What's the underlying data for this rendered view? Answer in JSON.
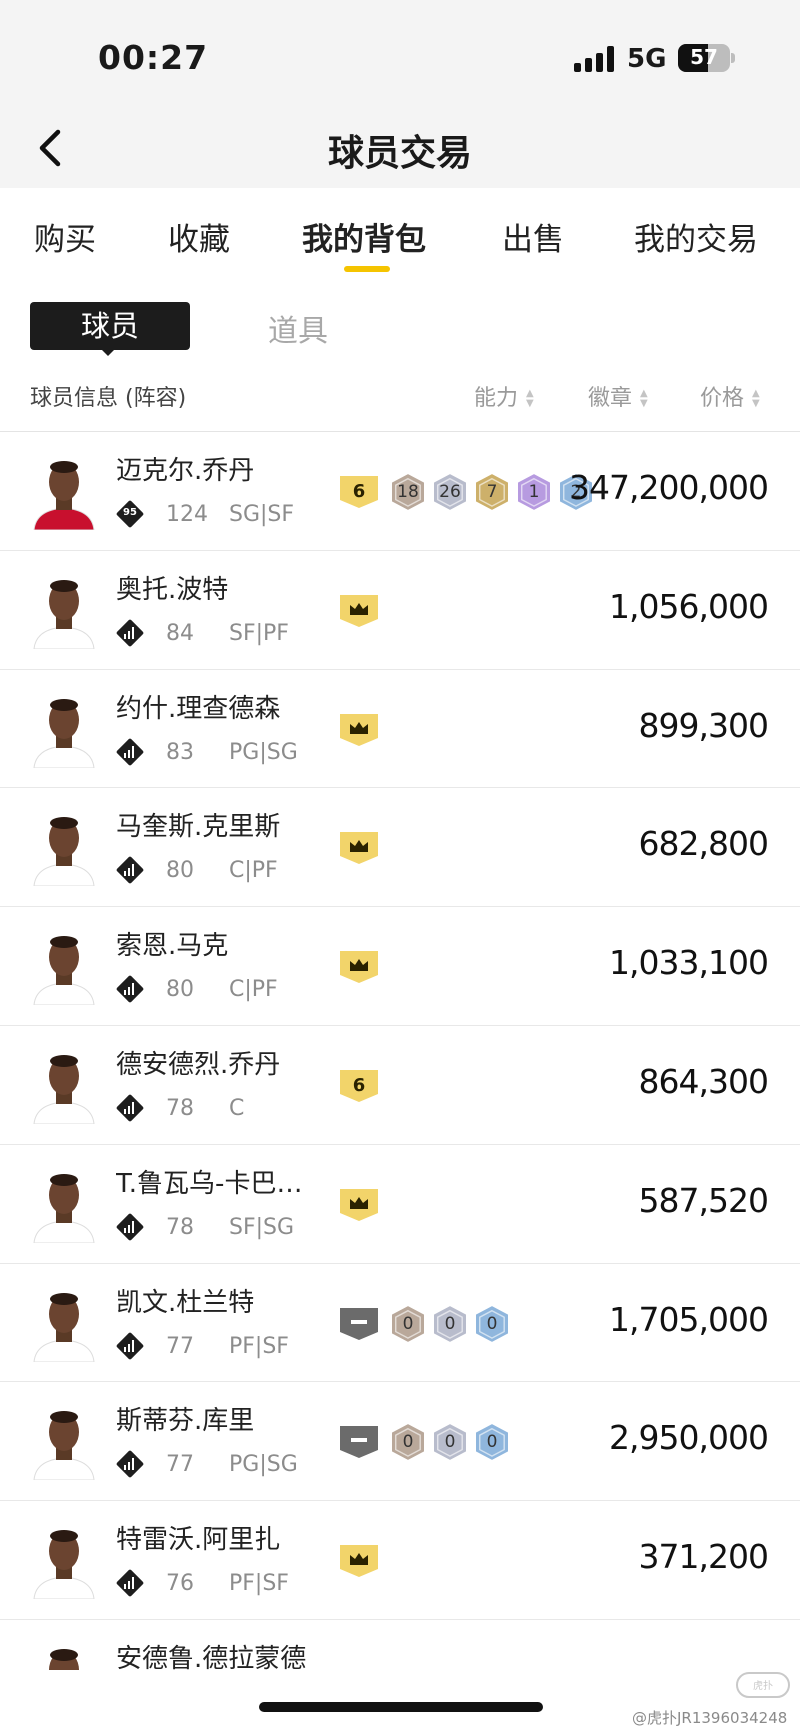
{
  "status_bar": {
    "time": "00:27",
    "network": "5G",
    "battery": "57",
    "battery_level": 0.57
  },
  "header": {
    "title": "球员交易",
    "back_icon": "chevron-left-icon"
  },
  "tabs": [
    {
      "label": "购买"
    },
    {
      "label": "收藏"
    },
    {
      "label": "我的背包",
      "active": true
    },
    {
      "label": "出售"
    },
    {
      "label": "我的交易"
    }
  ],
  "sub_tabs": {
    "player": "球员",
    "prop": "道具"
  },
  "columns": {
    "info": "球员信息 (阵容)",
    "ability": "能力",
    "badge": "徽章",
    "price": "价格"
  },
  "colors": {
    "accent": "#f5c400",
    "tier_gold": "#f2d46a",
    "tier_gray": "#6b6b6b",
    "badge_bronze": "#b9a89a",
    "badge_silver": "#b8bccc",
    "badge_gold": "#cdb06a",
    "badge_purple": "#b79be0",
    "badge_blue": "#8fb6dd"
  },
  "players": [
    {
      "name": "迈克尔.乔丹",
      "rating_badge": "95",
      "ovr": "124",
      "pos": "SG|SF",
      "tier": "6",
      "tier_kind": "number",
      "badges": [
        {
          "value": "18",
          "kind": "bronze"
        },
        {
          "value": "26",
          "kind": "silver"
        },
        {
          "value": "7",
          "kind": "gold"
        },
        {
          "value": "1",
          "kind": "purple"
        },
        {
          "value": "2",
          "kind": "blue"
        }
      ],
      "price": "347,200,000",
      "jersey": "#c8102e"
    },
    {
      "name": "奥托.波特",
      "ovr": "84",
      "pos": "SF|PF",
      "tier": "crown",
      "tier_kind": "crown",
      "badges": [],
      "price": "1,056,000",
      "jersey": "#ffffff"
    },
    {
      "name": "约什.理查德森",
      "ovr": "83",
      "pos": "PG|SG",
      "tier": "crown",
      "tier_kind": "crown",
      "badges": [],
      "price": "899,300",
      "jersey": "#ffffff"
    },
    {
      "name": "马奎斯.克里斯",
      "ovr": "80",
      "pos": "C|PF",
      "tier": "crown",
      "tier_kind": "crown",
      "badges": [],
      "price": "682,800",
      "jersey": "#ffffff"
    },
    {
      "name": "索恩.马克",
      "ovr": "80",
      "pos": "C|PF",
      "tier": "crown",
      "tier_kind": "crown",
      "badges": [],
      "price": "1,033,100",
      "jersey": "#ffffff"
    },
    {
      "name": "德安德烈.乔丹",
      "ovr": "78",
      "pos": "C",
      "tier": "6",
      "tier_kind": "number",
      "badges": [],
      "price": "864,300",
      "jersey": "#ffffff"
    },
    {
      "name": "T.鲁瓦乌-卡巴罗特",
      "ovr": "78",
      "pos": "SF|SG",
      "tier": "crown",
      "tier_kind": "crown",
      "badges": [],
      "price": "587,520",
      "jersey": "#ffffff"
    },
    {
      "name": "凯文.杜兰特",
      "ovr": "77",
      "pos": "PF|SF",
      "tier": "dash",
      "tier_kind": "dash",
      "badges": [
        {
          "value": "0",
          "kind": "bronze"
        },
        {
          "value": "0",
          "kind": "silver"
        },
        {
          "value": "0",
          "kind": "blue"
        }
      ],
      "price": "1,705,000",
      "jersey": "#ffffff"
    },
    {
      "name": "斯蒂芬.库里",
      "ovr": "77",
      "pos": "PG|SG",
      "tier": "dash",
      "tier_kind": "dash",
      "badges": [
        {
          "value": "0",
          "kind": "bronze"
        },
        {
          "value": "0",
          "kind": "silver"
        },
        {
          "value": "0",
          "kind": "blue"
        }
      ],
      "price": "2,950,000",
      "jersey": "#ffffff"
    },
    {
      "name": "特雷沃.阿里扎",
      "ovr": "76",
      "pos": "PF|SF",
      "tier": "crown",
      "tier_kind": "crown",
      "badges": [],
      "price": "371,200",
      "jersey": "#ffffff"
    },
    {
      "name": "安德鲁.德拉蒙德",
      "ovr": "",
      "pos": "",
      "tier": "",
      "tier_kind": "none",
      "badges": [],
      "price": "",
      "jersey": "#ffffff"
    }
  ],
  "watermark": "@虎扑JR1396034248",
  "watermark_logo": "hupu"
}
